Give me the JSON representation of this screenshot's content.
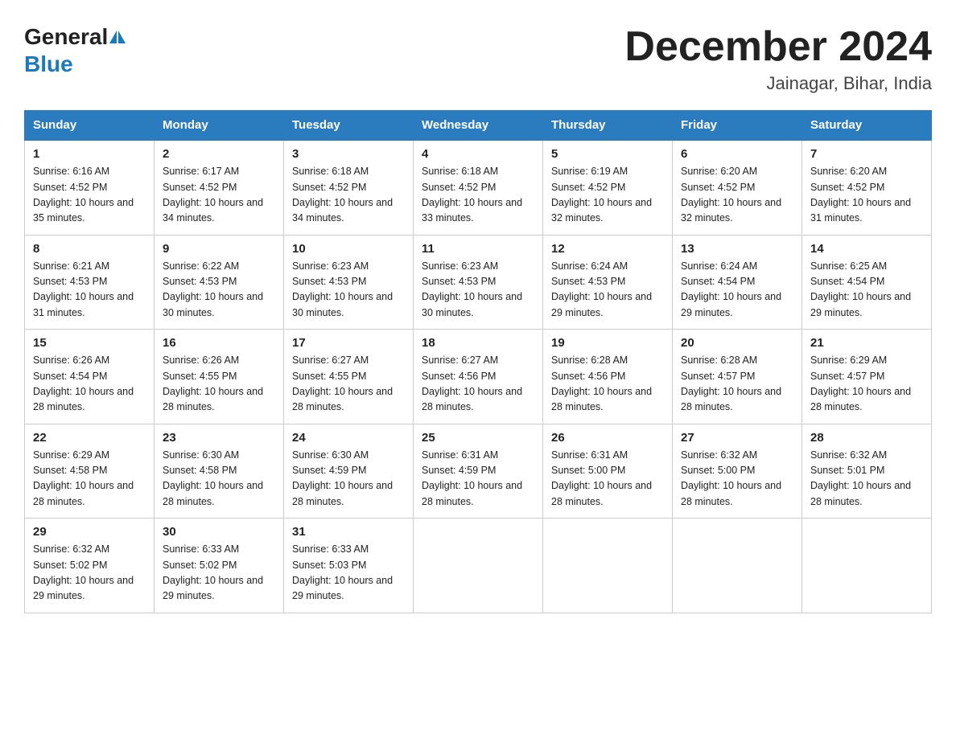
{
  "header": {
    "logo_general": "General",
    "logo_blue": "Blue",
    "month_title": "December 2024",
    "subtitle": "Jainagar, Bihar, India"
  },
  "weekdays": [
    "Sunday",
    "Monday",
    "Tuesday",
    "Wednesday",
    "Thursday",
    "Friday",
    "Saturday"
  ],
  "weeks": [
    [
      {
        "day": "1",
        "sunrise": "6:16 AM",
        "sunset": "4:52 PM",
        "daylight": "10 hours and 35 minutes."
      },
      {
        "day": "2",
        "sunrise": "6:17 AM",
        "sunset": "4:52 PM",
        "daylight": "10 hours and 34 minutes."
      },
      {
        "day": "3",
        "sunrise": "6:18 AM",
        "sunset": "4:52 PM",
        "daylight": "10 hours and 34 minutes."
      },
      {
        "day": "4",
        "sunrise": "6:18 AM",
        "sunset": "4:52 PM",
        "daylight": "10 hours and 33 minutes."
      },
      {
        "day": "5",
        "sunrise": "6:19 AM",
        "sunset": "4:52 PM",
        "daylight": "10 hours and 32 minutes."
      },
      {
        "day": "6",
        "sunrise": "6:20 AM",
        "sunset": "4:52 PM",
        "daylight": "10 hours and 32 minutes."
      },
      {
        "day": "7",
        "sunrise": "6:20 AM",
        "sunset": "4:52 PM",
        "daylight": "10 hours and 31 minutes."
      }
    ],
    [
      {
        "day": "8",
        "sunrise": "6:21 AM",
        "sunset": "4:53 PM",
        "daylight": "10 hours and 31 minutes."
      },
      {
        "day": "9",
        "sunrise": "6:22 AM",
        "sunset": "4:53 PM",
        "daylight": "10 hours and 30 minutes."
      },
      {
        "day": "10",
        "sunrise": "6:23 AM",
        "sunset": "4:53 PM",
        "daylight": "10 hours and 30 minutes."
      },
      {
        "day": "11",
        "sunrise": "6:23 AM",
        "sunset": "4:53 PM",
        "daylight": "10 hours and 30 minutes."
      },
      {
        "day": "12",
        "sunrise": "6:24 AM",
        "sunset": "4:53 PM",
        "daylight": "10 hours and 29 minutes."
      },
      {
        "day": "13",
        "sunrise": "6:24 AM",
        "sunset": "4:54 PM",
        "daylight": "10 hours and 29 minutes."
      },
      {
        "day": "14",
        "sunrise": "6:25 AM",
        "sunset": "4:54 PM",
        "daylight": "10 hours and 29 minutes."
      }
    ],
    [
      {
        "day": "15",
        "sunrise": "6:26 AM",
        "sunset": "4:54 PM",
        "daylight": "10 hours and 28 minutes."
      },
      {
        "day": "16",
        "sunrise": "6:26 AM",
        "sunset": "4:55 PM",
        "daylight": "10 hours and 28 minutes."
      },
      {
        "day": "17",
        "sunrise": "6:27 AM",
        "sunset": "4:55 PM",
        "daylight": "10 hours and 28 minutes."
      },
      {
        "day": "18",
        "sunrise": "6:27 AM",
        "sunset": "4:56 PM",
        "daylight": "10 hours and 28 minutes."
      },
      {
        "day": "19",
        "sunrise": "6:28 AM",
        "sunset": "4:56 PM",
        "daylight": "10 hours and 28 minutes."
      },
      {
        "day": "20",
        "sunrise": "6:28 AM",
        "sunset": "4:57 PM",
        "daylight": "10 hours and 28 minutes."
      },
      {
        "day": "21",
        "sunrise": "6:29 AM",
        "sunset": "4:57 PM",
        "daylight": "10 hours and 28 minutes."
      }
    ],
    [
      {
        "day": "22",
        "sunrise": "6:29 AM",
        "sunset": "4:58 PM",
        "daylight": "10 hours and 28 minutes."
      },
      {
        "day": "23",
        "sunrise": "6:30 AM",
        "sunset": "4:58 PM",
        "daylight": "10 hours and 28 minutes."
      },
      {
        "day": "24",
        "sunrise": "6:30 AM",
        "sunset": "4:59 PM",
        "daylight": "10 hours and 28 minutes."
      },
      {
        "day": "25",
        "sunrise": "6:31 AM",
        "sunset": "4:59 PM",
        "daylight": "10 hours and 28 minutes."
      },
      {
        "day": "26",
        "sunrise": "6:31 AM",
        "sunset": "5:00 PM",
        "daylight": "10 hours and 28 minutes."
      },
      {
        "day": "27",
        "sunrise": "6:32 AM",
        "sunset": "5:00 PM",
        "daylight": "10 hours and 28 minutes."
      },
      {
        "day": "28",
        "sunrise": "6:32 AM",
        "sunset": "5:01 PM",
        "daylight": "10 hours and 28 minutes."
      }
    ],
    [
      {
        "day": "29",
        "sunrise": "6:32 AM",
        "sunset": "5:02 PM",
        "daylight": "10 hours and 29 minutes."
      },
      {
        "day": "30",
        "sunrise": "6:33 AM",
        "sunset": "5:02 PM",
        "daylight": "10 hours and 29 minutes."
      },
      {
        "day": "31",
        "sunrise": "6:33 AM",
        "sunset": "5:03 PM",
        "daylight": "10 hours and 29 minutes."
      },
      null,
      null,
      null,
      null
    ]
  ]
}
